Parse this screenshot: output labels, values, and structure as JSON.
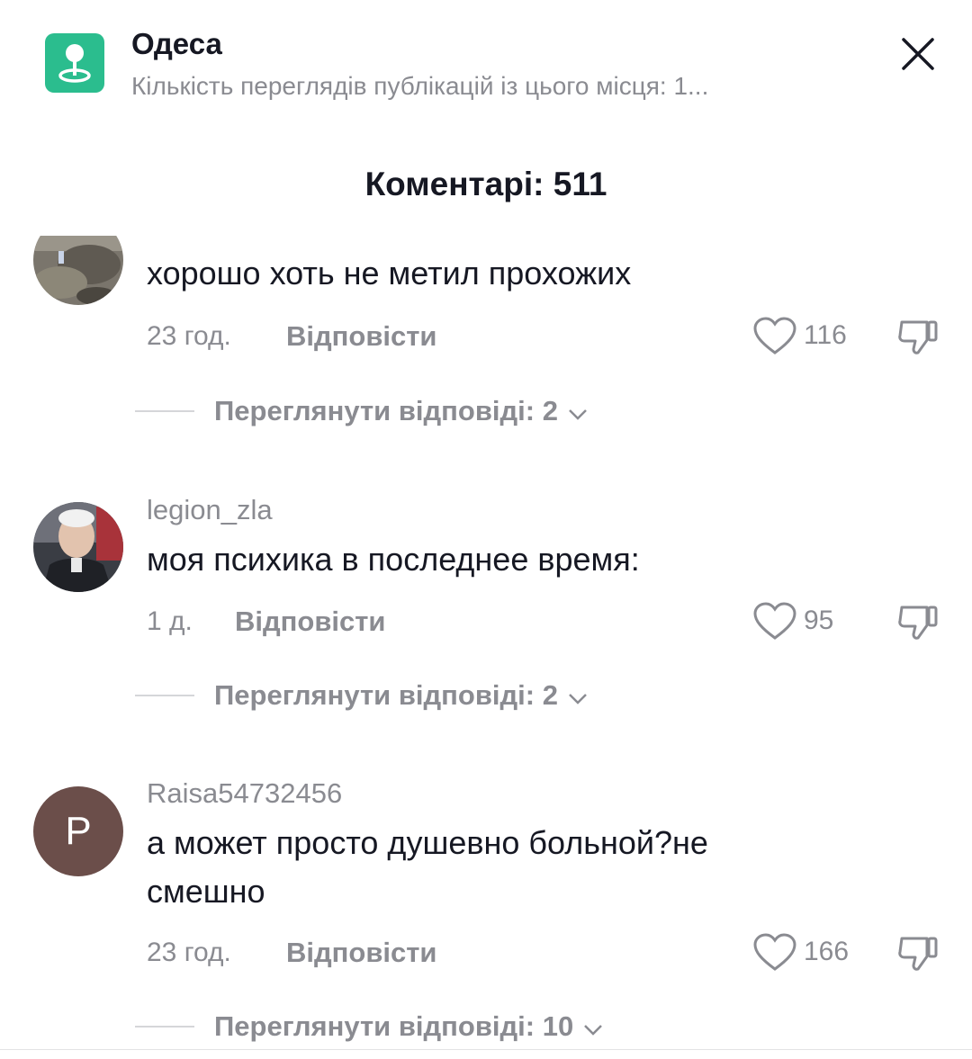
{
  "location": {
    "name": "Одеса",
    "subtitle": "Кількість переглядів публікацій із цього місця: 1..."
  },
  "comments_title": "Коментарі: 511",
  "comments": [
    {
      "username": "",
      "text": "хорошо хоть не метил прохожих",
      "time": "23 год.",
      "reply_label": "Відповісти",
      "likes": "116",
      "view_replies": "Переглянути відповіді: 2"
    },
    {
      "username": "legion_zla",
      "text": "моя психика в последнее время:",
      "time": "1 д.",
      "reply_label": "Відповісти",
      "likes": "95",
      "view_replies": "Переглянути відповіді: 2"
    },
    {
      "username": "Raisa54732456",
      "avatar_letter": "P",
      "text": "а может просто душевно больной?не смешно",
      "time": "23 год.",
      "reply_label": "Відповісти",
      "likes": "166",
      "view_replies": "Переглянути відповіді: 10"
    }
  ],
  "colors": {
    "location_icon": "#2bbd8e",
    "avatar_letter_bg": "#6b4e4a",
    "muted_text": "#8a8b91"
  },
  "icons": [
    "map-pin-icon",
    "close-icon",
    "heart-icon",
    "thumbs-down-icon",
    "chevron-down-icon"
  ]
}
